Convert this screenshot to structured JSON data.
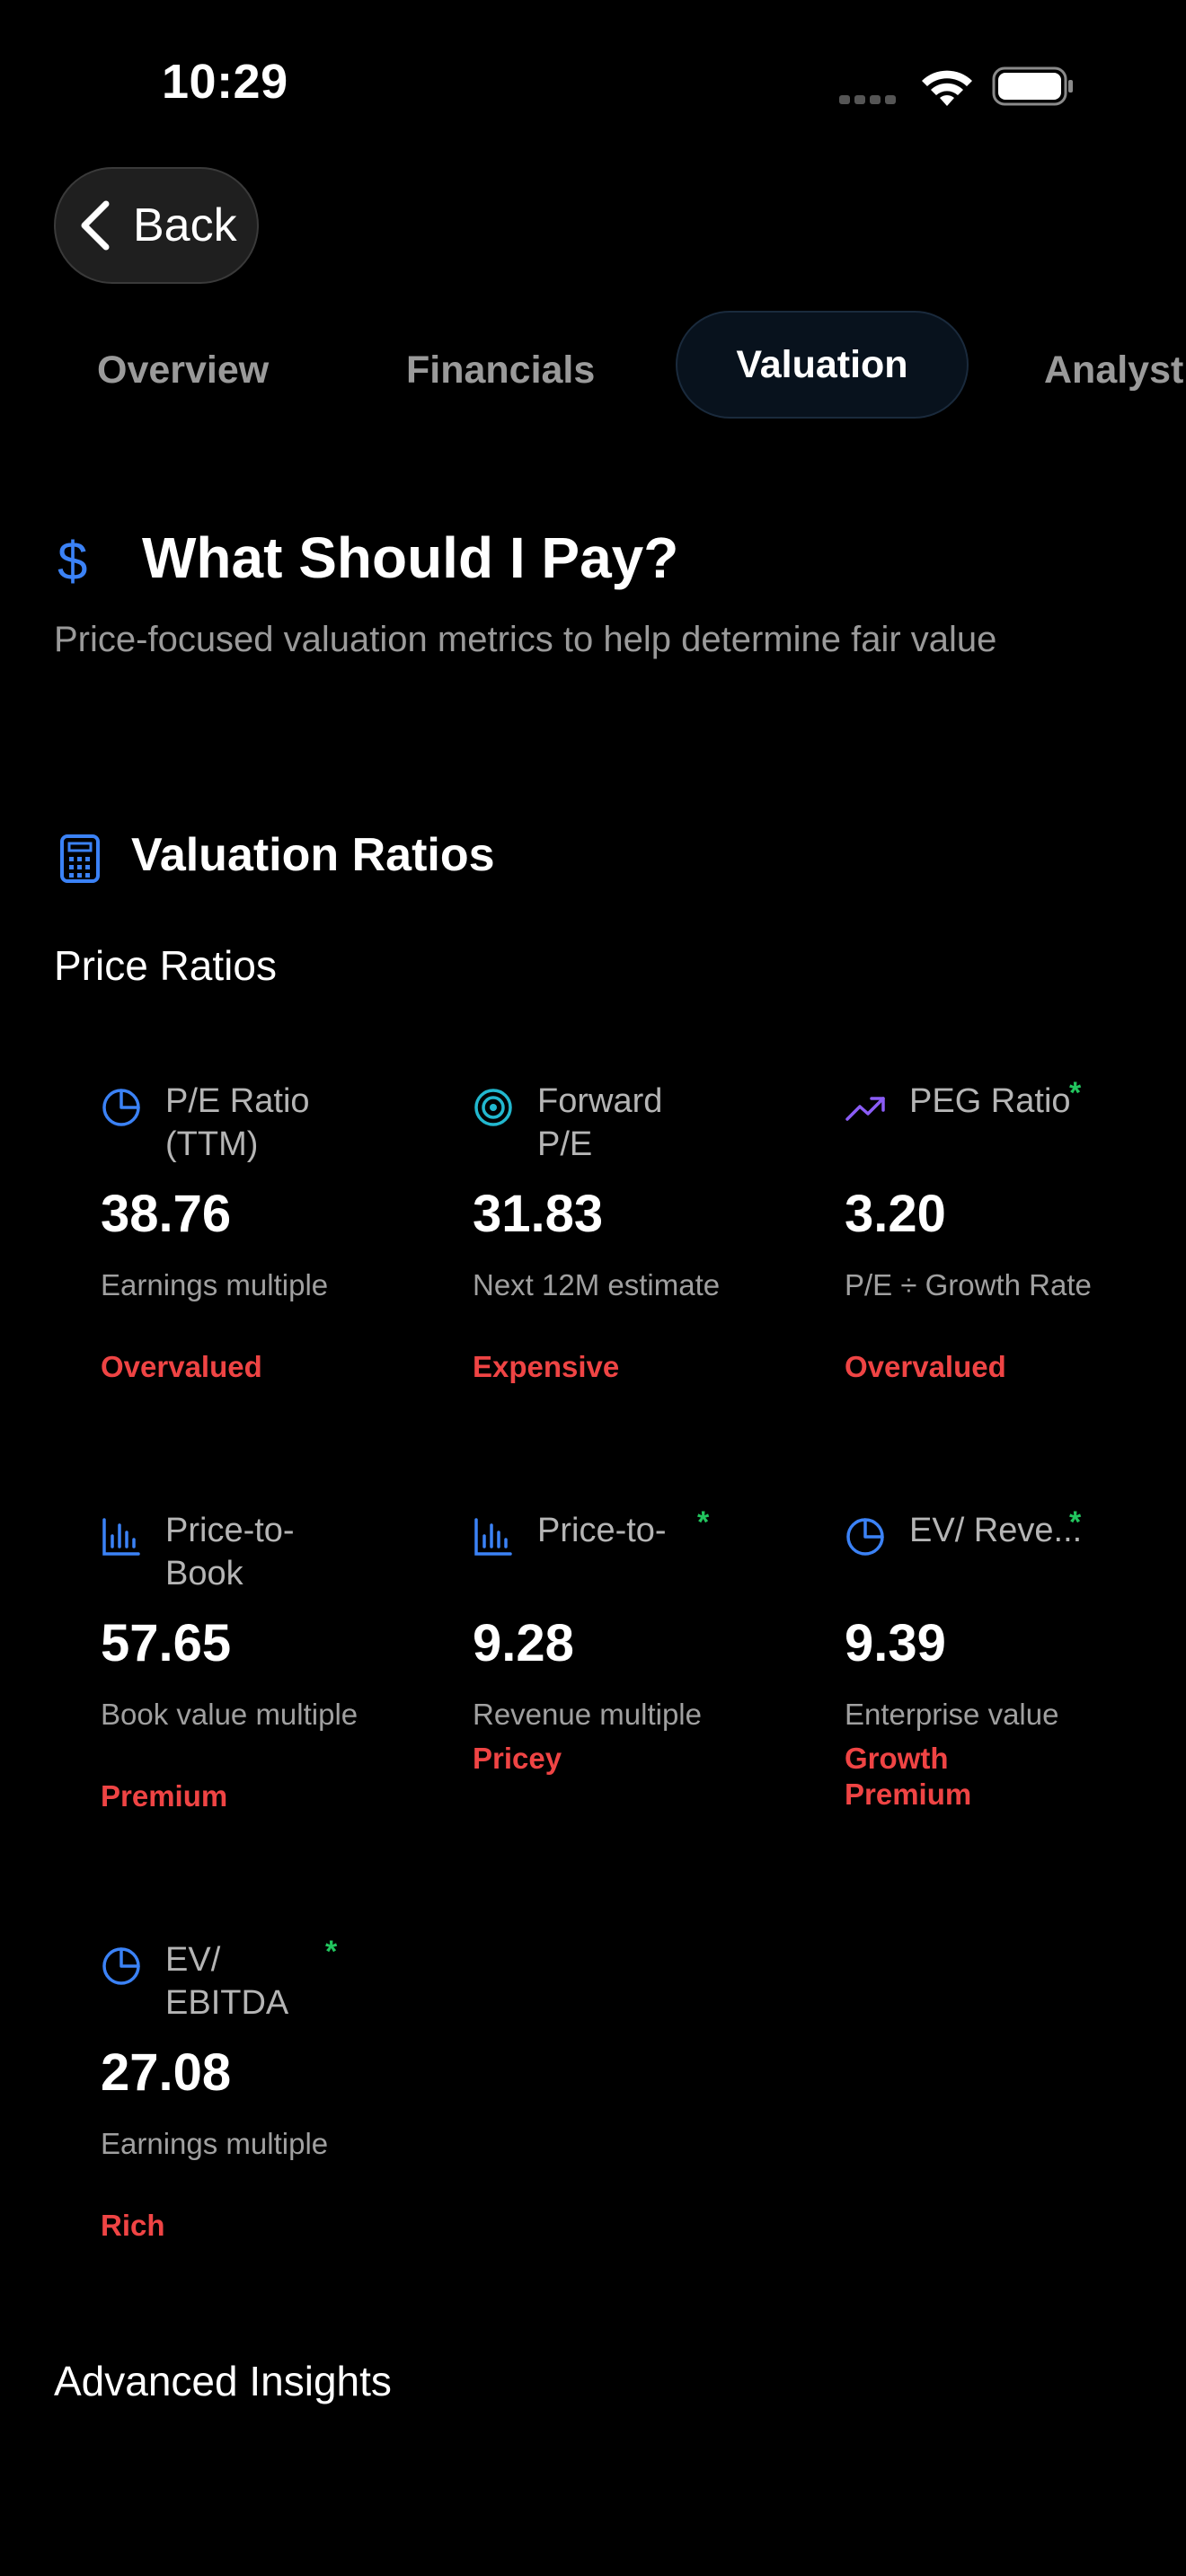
{
  "status_bar": {
    "time": "10:29"
  },
  "nav": {
    "back_label": "Back"
  },
  "tabs": [
    {
      "label": "Overview"
    },
    {
      "label": "Financials"
    },
    {
      "label": "Valuation",
      "active": true
    },
    {
      "label": "Analyst"
    }
  ],
  "header": {
    "icon": "dollar-icon",
    "title": "What Should I Pay?",
    "subtitle": "Price-focused valuation metrics to help determine fair value"
  },
  "section": {
    "icon": "calculator-icon",
    "title": "Valuation Ratios",
    "group_title": "Price Ratios"
  },
  "metrics": [
    {
      "icon": "pie-chart-icon",
      "title": "P/E Ratio (TTM)",
      "value": "38.76",
      "desc": "Earnings multiple",
      "status": "Overvalued",
      "starred": false
    },
    {
      "icon": "target-icon",
      "title": "Forward P/E",
      "value": "31.83",
      "desc": "Next 12M estimate",
      "status": "Expensive",
      "starred": false
    },
    {
      "icon": "trending-up-icon",
      "title": "PEG Ratio",
      "value": "3.20",
      "desc": "P/E ÷ Growth Rate",
      "status": "Overvalued",
      "starred": true,
      "star": "*"
    },
    {
      "icon": "bar-chart-icon",
      "title": "Price-to-Book",
      "value": "57.65",
      "desc": "Book value multiple",
      "status": "Premium",
      "starred": false
    },
    {
      "icon": "bar-chart-icon",
      "title": "Price-to-",
      "value": "9.28",
      "desc": "Revenue multiple",
      "status": "Pricey",
      "starred": true,
      "star": "*"
    },
    {
      "icon": "pie-chart-icon",
      "title": "EV/ Reve...",
      "value": "9.39",
      "desc": "Enterprise value",
      "status": "Growth Premium",
      "starred": true,
      "star": "*"
    },
    {
      "icon": "pie-chart-icon",
      "title": "EV/ EBITDA",
      "value": "27.08",
      "desc": "Earnings multiple",
      "status": "Rich",
      "starred": true,
      "star": "*"
    }
  ],
  "footer_section": {
    "title": "Advanced Insights"
  },
  "colors": {
    "accent_blue": "#3b82f6",
    "accent_cyan": "#22b8cf",
    "accent_purple": "#8b5cf6",
    "status_red": "#ef4444",
    "star_green": "#22c55e",
    "background": "#000000"
  }
}
